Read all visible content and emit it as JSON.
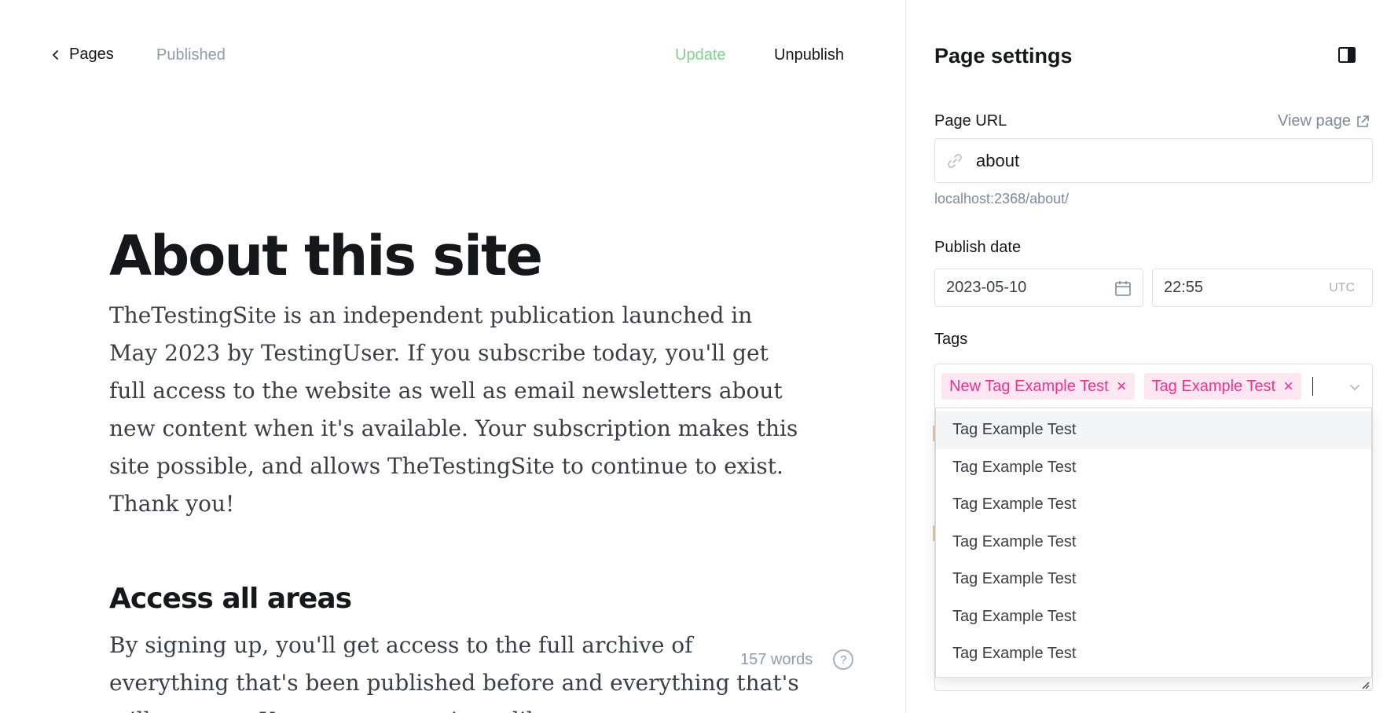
{
  "editor": {
    "back_label": "Pages",
    "status": "Published",
    "update_label": "Update",
    "unpublish_label": "Unpublish",
    "title": "About this site",
    "paragraph1": "TheTestingSite is an independent publication launched in May 2023 by TestingUser. If you subscribe today, you'll get full access to the website as well as email newsletters about new content when it's available. Your subscription makes this site possible, and allows TheTestingSite to continue to exist. Thank you!",
    "heading2": "Access all areas",
    "paragraph2": "By signing up, you'll get access to the full archive of everything that's been published before and everything that's still to come. Your very own private library.",
    "word_count": "157 words",
    "help_glyph": "?"
  },
  "settings": {
    "title": "Page settings",
    "page_url_label": "Page URL",
    "view_page_label": "View page",
    "url_value": "about",
    "url_hint": "localhost:2368/about/",
    "publish_date_label": "Publish date",
    "date_value": "2023-05-10",
    "time_value": "22:55",
    "timezone": "UTC",
    "tags_label": "Tags",
    "selected_tags": [
      "New Tag Example Test",
      "Tag Example Test"
    ],
    "tag_remove_glyph": "×",
    "dropdown_options": [
      "Tag Example Test",
      "Tag Example Test",
      "Tag Example Test",
      "Tag Example Test",
      "Tag Example Test",
      "Tag Example Test",
      "Tag Example Test"
    ],
    "highlighted_option_index": 0
  },
  "colors": {
    "update_green": "#7ed48a",
    "tag_pink": "#fb2d8d",
    "tag_bg": "#fde7f1",
    "muted": "#8e9cac"
  }
}
